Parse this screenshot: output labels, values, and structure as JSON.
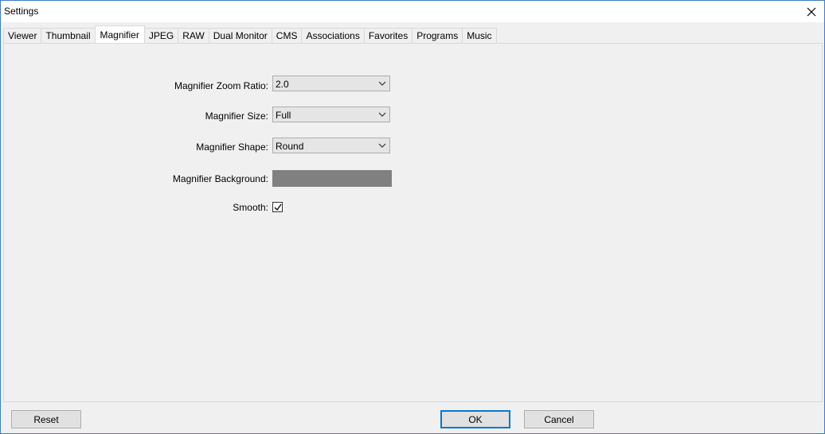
{
  "window": {
    "title": "Settings"
  },
  "tabs": [
    {
      "label": "Viewer"
    },
    {
      "label": "Thumbnail"
    },
    {
      "label": "Magnifier",
      "active": true
    },
    {
      "label": "JPEG"
    },
    {
      "label": "RAW"
    },
    {
      "label": "Dual Monitor"
    },
    {
      "label": "CMS"
    },
    {
      "label": "Associations"
    },
    {
      "label": "Favorites"
    },
    {
      "label": "Programs"
    },
    {
      "label": "Music"
    }
  ],
  "magnifier": {
    "zoom_ratio_label": "Magnifier Zoom Ratio:",
    "zoom_ratio_value": "2.0",
    "size_label": "Magnifier Size:",
    "size_value": "Full",
    "shape_label": "Magnifier Shape:",
    "shape_value": "Round",
    "background_label": "Magnifier Background:",
    "background_color": "#808080",
    "smooth_label": "Smooth:",
    "smooth_checked": true
  },
  "buttons": {
    "reset": "Reset",
    "ok": "OK",
    "cancel": "Cancel"
  },
  "icons": {
    "close": "close-icon",
    "dropdown": "chevron-down-icon",
    "check": "checkmark-icon"
  }
}
